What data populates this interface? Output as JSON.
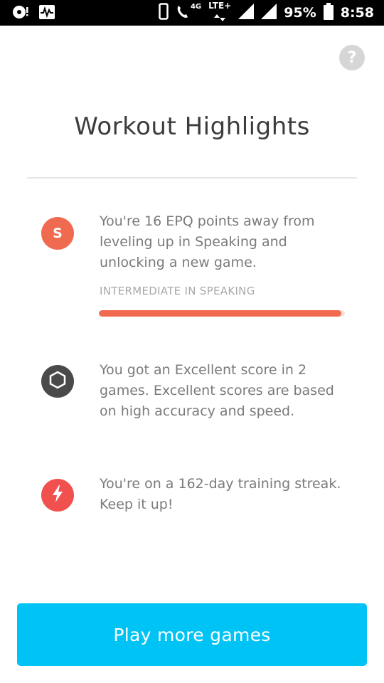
{
  "status_bar": {
    "network_badge": "4G",
    "lte_label": "LTE+",
    "battery_percent": "95%",
    "time": "8:58"
  },
  "help": {
    "label": "?"
  },
  "page": {
    "title": "Workout Highlights"
  },
  "highlights": [
    {
      "badge_letter": "S",
      "badge_color": "#ef6a4f",
      "text": "You're 16 EPQ points away from leveling up in Speaking and unlocking a new game.",
      "level_label": "INTERMEDIATE IN SPEAKING",
      "progress": 0.985
    },
    {
      "badge_color": "#4a4a4a",
      "icon": "hexagon-icon",
      "text": "You got an Excellent score in 2 games. Excellent scores are based on high accuracy and speed."
    },
    {
      "badge_color": "#f0514f",
      "icon": "lightning-icon",
      "text": "You're on a 162-day training streak. Keep it up!"
    }
  ],
  "cta": {
    "label": "Play more games",
    "color": "#00c3f5"
  }
}
